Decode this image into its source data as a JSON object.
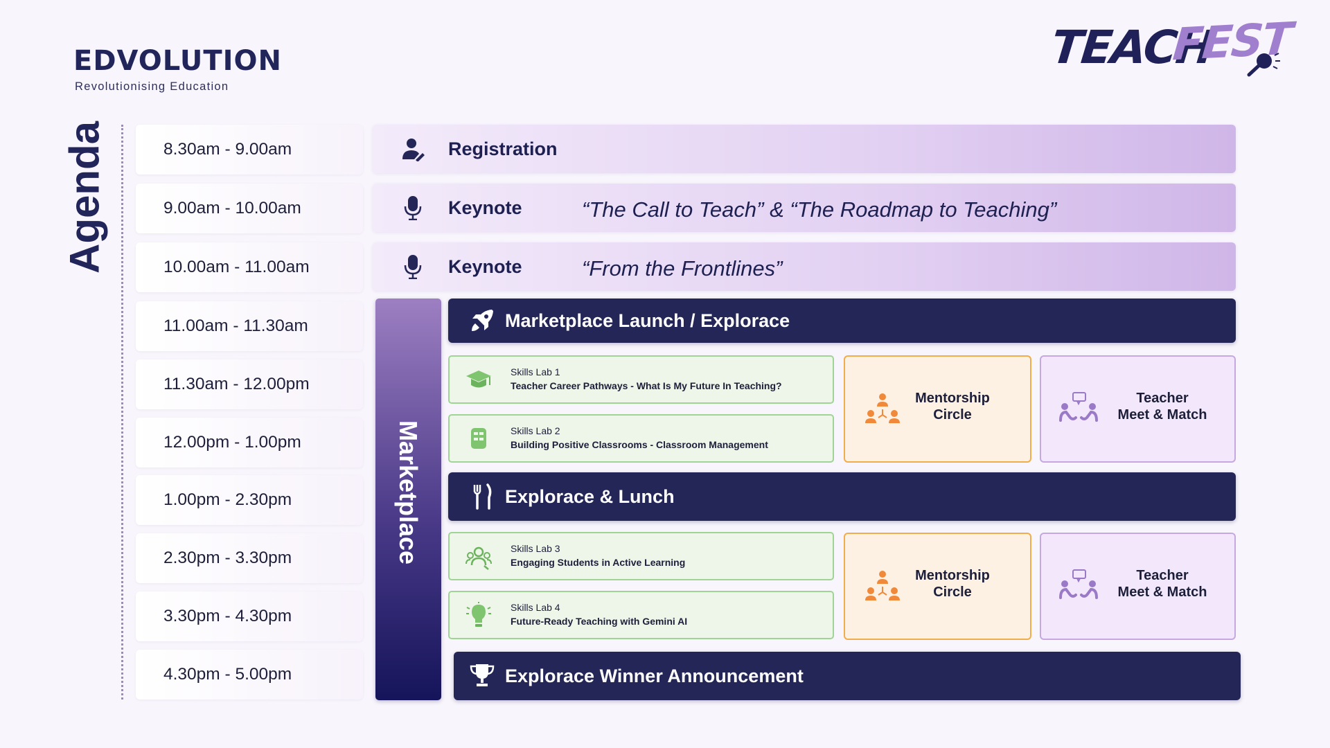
{
  "logos": {
    "left_wordmark": "EDVOLUTION",
    "left_tagline": "Revolutionising Education",
    "right_teach": "TEACH",
    "right_fest": "FEST"
  },
  "agenda_title": "Agenda",
  "times": [
    "8.30am - 9.00am",
    "9.00am - 10.00am",
    "10.00am - 11.00am",
    "11.00am - 11.30am",
    "11.30am - 12.00pm",
    "12.00pm - 1.00pm",
    "1.00pm - 2.30pm",
    "2.30pm - 3.30pm",
    "3.30pm - 4.30pm",
    "4.30pm - 5.00pm"
  ],
  "sessions": {
    "registration": {
      "label": "Registration",
      "icon": "user-pen-icon"
    },
    "keynote1": {
      "label": "Keynote",
      "quote": "“The Call to Teach” & “The Roadmap to Teaching”",
      "icon": "microphone-icon"
    },
    "keynote2": {
      "label": "Keynote",
      "quote": "“From the Frontlines”",
      "icon": "microphone-icon"
    }
  },
  "marketplace": {
    "label": "Marketplace"
  },
  "blocks": {
    "launch": {
      "label": "Marketplace Launch / Explorace",
      "icon": "rocket-icon"
    },
    "lunch": {
      "label": "Explorace & Lunch",
      "icon": "fork-knife-icon"
    },
    "winner": {
      "label": "Explorace Winner Announcement",
      "icon": "trophy-icon"
    }
  },
  "labs": [
    {
      "title": "Skills Lab 1",
      "desc": "Teacher Career Pathways - What Is My Future In Teaching?",
      "icon": "graduation-cap-icon"
    },
    {
      "title": "Skills Lab 2",
      "desc": "Building Positive Classrooms - Classroom Management",
      "icon": "classroom-icon"
    },
    {
      "title": "Skills Lab 3",
      "desc": "Engaging Students in Active Learning",
      "icon": "group-icon"
    },
    {
      "title": "Skills Lab 4",
      "desc": "Future-Ready Teaching with Gemini AI",
      "icon": "ai-bulb-icon"
    }
  ],
  "side": {
    "mentor_line1": "Mentorship",
    "mentor_line2": "Circle",
    "teacher_line1": "Teacher",
    "teacher_line2": "Meet & Match"
  },
  "colors": {
    "navy": "#232656",
    "lavender": "#e2d0f2",
    "lab_green": "#9fd494",
    "mentor_orange": "#f1ad4c",
    "teacher_purple": "#c5a8e2"
  }
}
